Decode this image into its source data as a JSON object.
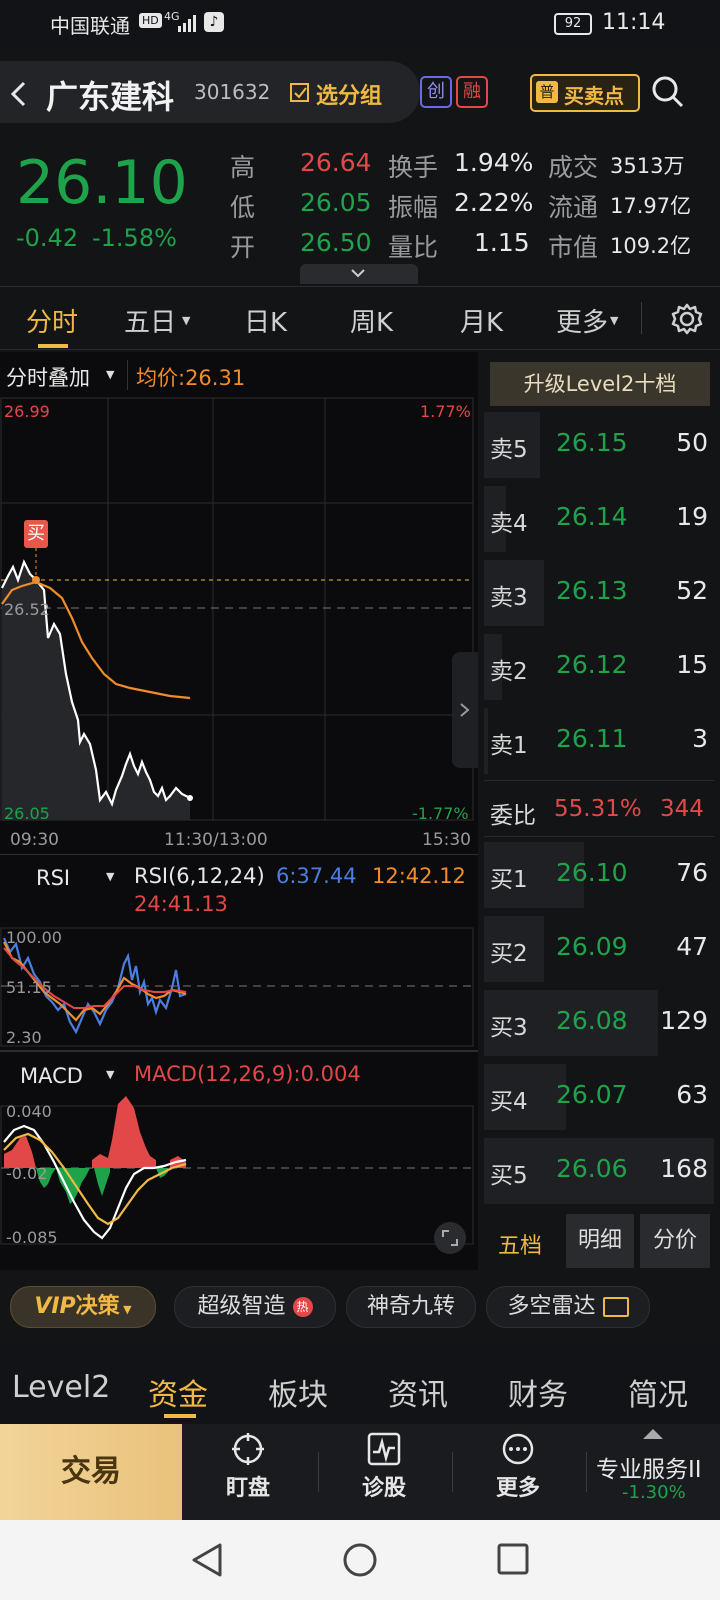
{
  "status": {
    "carrier": "中国联通",
    "hd": "HD",
    "net": "4G",
    "battery": "92",
    "time": "11:14"
  },
  "header": {
    "back_icon": "chevron-left-icon",
    "stock_name": "广东建科",
    "stock_code": "301632",
    "group_label": "选分组",
    "badge_chuang": "创",
    "badge_rong": "融",
    "buy_sell_badge": "普",
    "buy_sell_label": "买卖点",
    "search_icon": "search-icon"
  },
  "quote": {
    "price": "26.10",
    "change": "-0.42",
    "change_pct": "-1.58%",
    "high_label": "高",
    "high": "26.64",
    "low_label": "低",
    "low": "26.05",
    "open_label": "开",
    "open": "26.50",
    "turnover_label": "换手",
    "turnover": "1.94%",
    "amplitude_label": "振幅",
    "amplitude": "2.22%",
    "vol_ratio_label": "量比",
    "vol_ratio": "1.15",
    "deal_label": "成交",
    "deal": "3513万",
    "float_label": "流通",
    "float": "17.97亿",
    "mktcap_label": "市值",
    "mktcap": "109.2亿"
  },
  "tabs": {
    "t1": "分时",
    "t2": "五日",
    "t3": "日K",
    "t4": "周K",
    "t5": "月K",
    "t6": "更多"
  },
  "intraday": {
    "overlay_label": "分时叠加",
    "avg_label": "均价:26.31",
    "y_top": "26.99",
    "y_mid": "26.52",
    "y_bottom": "26.05",
    "pct_top": "1.77%",
    "pct_bottom": "-1.77%",
    "t_start": "09:30",
    "t_mid": "11:30/13:00",
    "t_end": "15:30",
    "buy_marker": "买"
  },
  "rsi": {
    "label": "RSI",
    "params": "RSI(6,12,24)",
    "v6": "6:37.44",
    "v12": "12:42.12",
    "v24": "24:41.13",
    "y_top": "100.00",
    "y_mid": "51.15",
    "y_bottom": "2.30"
  },
  "macd": {
    "label": "MACD",
    "value": "MACD(12,26,9):0.004",
    "y_top": "0.040",
    "y_mid": "-0.02",
    "y_bottom": "-0.085"
  },
  "orderbook": {
    "upgrade_label": "升级Level2十档",
    "sells": [
      {
        "label": "卖5",
        "price": "26.15",
        "vol": "50"
      },
      {
        "label": "卖4",
        "price": "26.14",
        "vol": "19"
      },
      {
        "label": "卖3",
        "price": "26.13",
        "vol": "52"
      },
      {
        "label": "卖2",
        "price": "26.12",
        "vol": "15"
      },
      {
        "label": "卖1",
        "price": "26.11",
        "vol": "3"
      }
    ],
    "ratio_label": "委比",
    "ratio_pct": "55.31%",
    "ratio_val": "344",
    "buys": [
      {
        "label": "买1",
        "price": "26.10",
        "vol": "76"
      },
      {
        "label": "买2",
        "price": "26.09",
        "vol": "47"
      },
      {
        "label": "买3",
        "price": "26.08",
        "vol": "129"
      },
      {
        "label": "买4",
        "price": "26.07",
        "vol": "63"
      },
      {
        "label": "买5",
        "price": "26.06",
        "vol": "168"
      }
    ],
    "tab_five": "五档",
    "tab_detail": "明细",
    "tab_price": "分价"
  },
  "chips": {
    "vip": "VIP",
    "vip_label": "决策",
    "super": "超级智造",
    "hot": "热",
    "nine": "神奇九转",
    "radar": "多空雷达"
  },
  "bottom_tabs": {
    "b1": "Level2",
    "b2": "资金",
    "b3": "板块",
    "b4": "资讯",
    "b5": "财务",
    "b6": "简况"
  },
  "action_bar": {
    "trade": "交易",
    "watch": "盯盘",
    "diagnose": "诊股",
    "more": "更多",
    "service": "专业服务II",
    "service_change": "-1.30%"
  },
  "colors": {
    "up": "#e24848",
    "down": "#1ea34a",
    "avg_line": "#f08c2a",
    "gold": "#f0b844"
  }
}
